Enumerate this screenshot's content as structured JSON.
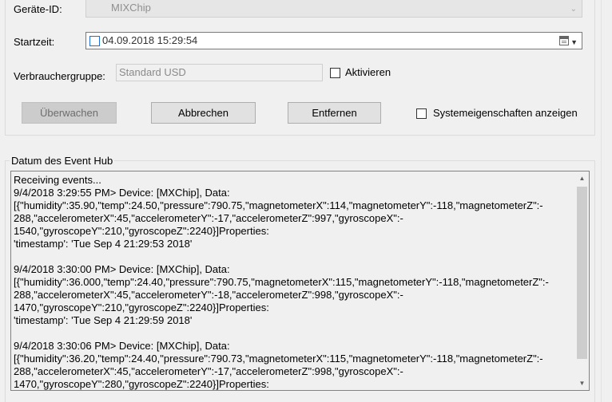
{
  "form": {
    "device_id_label": "Geräte-ID:",
    "device_id_value": "MIXChip",
    "start_time_label": "Startzeit:",
    "start_time_value": "04.09.2018 15:29:54",
    "consumer_group_label": "Verbrauchergruppe:",
    "consumer_group_value": "Standard USD",
    "activate_label": "Aktivieren"
  },
  "buttons": {
    "monitor": "Überwachen",
    "cancel": "Abbrechen",
    "remove": "Entfernen"
  },
  "system_props_label": "Systemeigenschaften anzeigen",
  "event_hub": {
    "title": "Datum des Event Hub",
    "lines": [
      "Receiving events...",
      "9/4/2018 3:29:55 PM> Device: [MXChip], Data:",
      "[{\"humidity\":35.90,\"temp\":24.50,\"pressure\":790.75,\"magnetometerX\":114,\"magnetometerY\":-118,\"magnetometerZ\":-",
      "288,\"accelerometerX\":45,\"accelerometerY\":-17,\"accelerometerZ\":997,\"gyroscopeX\":-",
      "1540,\"gyroscopeY\":210,\"gyroscopeZ\":2240}]Properties:",
      "'timestamp': 'Tue Sep  4 21:29:53 2018'",
      "",
      "9/4/2018 3:30:00 PM> Device: [MXChip], Data:",
      "[{\"humidity\":36.000,\"temp\":24.40,\"pressure\":790.75,\"magnetometerX\":115,\"magnetometerY\":-118,\"magnetometerZ\":-",
      "288,\"accelerometerX\":45,\"accelerometerY\":-18,\"accelerometerZ\":998,\"gyroscopeX\":-",
      "1470,\"gyroscopeY\":210,\"gyroscopeZ\":2240}]Properties:",
      "'timestamp': 'Tue Sep  4 21:29:59 2018'",
      "",
      "9/4/2018 3:30:06 PM> Device: [MXChip], Data:",
      "[{\"humidity\":36.20,\"temp\":24.40,\"pressure\":790.73,\"magnetometerX\":115,\"magnetometerY\":-118,\"magnetometerZ\":-",
      "288,\"accelerometerX\":45,\"accelerometerY\":-17,\"accelerometerZ\":998,\"gyroscopeX\":-",
      "1470,\"gyroscopeY\":280,\"gyroscopeZ\":2240}]Properties:"
    ]
  },
  "icons": {
    "dropdown": "chevron-down-icon",
    "calendar": "calendar-icon",
    "scroll_up": "arrow-up-icon",
    "scroll_down": "arrow-down-icon"
  },
  "colors": {
    "window_bg": "#f0f0f0",
    "disabled_text": "#8f8f8f",
    "checkbox_accent": "#1e6fd9"
  }
}
